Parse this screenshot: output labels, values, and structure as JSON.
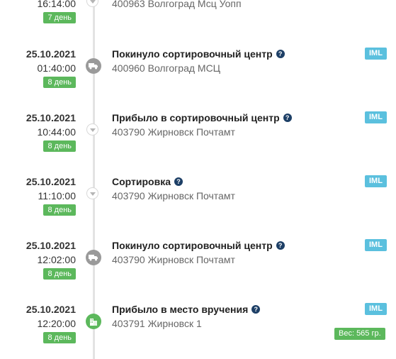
{
  "events": [
    {
      "date": "",
      "time": "16:14:00",
      "day": "7 день",
      "status": "",
      "location": "400963 Волгоград Мсц Уопп",
      "carrier": "",
      "node": "chevron"
    },
    {
      "date": "25.10.2021",
      "time": "01:40:00",
      "day": "8 день",
      "status": "Покинуло сортировочный центр",
      "location": "400960 Волгоград МСЦ",
      "carrier": "IML",
      "node": "truck"
    },
    {
      "date": "25.10.2021",
      "time": "10:44:00",
      "day": "8 день",
      "status": "Прибыло в сортировочный центр",
      "location": "403790 Жирновск Почтамт",
      "carrier": "IML",
      "node": "chevron"
    },
    {
      "date": "25.10.2021",
      "time": "11:10:00",
      "day": "8 день",
      "status": "Сортировка",
      "location": "403790 Жирновск Почтамт",
      "carrier": "IML",
      "node": "chevron"
    },
    {
      "date": "25.10.2021",
      "time": "12:02:00",
      "day": "8 день",
      "status": "Покинуло сортировочный центр",
      "location": "403790 Жирновск Почтамт",
      "carrier": "IML",
      "node": "truck"
    },
    {
      "date": "25.10.2021",
      "time": "12:20:00",
      "day": "8 день",
      "status": "Прибыло в место вручения",
      "location": "403791 Жирновск 1",
      "carrier": "IML",
      "node": "building"
    }
  ],
  "help_glyph": "?",
  "weight": "Вес: 565 гр.",
  "colors": {
    "day_badge": "#5cb85c",
    "carrier_badge": "#5bc0de",
    "help_icon": "#1d3f66",
    "line": "#e3e3e3"
  }
}
